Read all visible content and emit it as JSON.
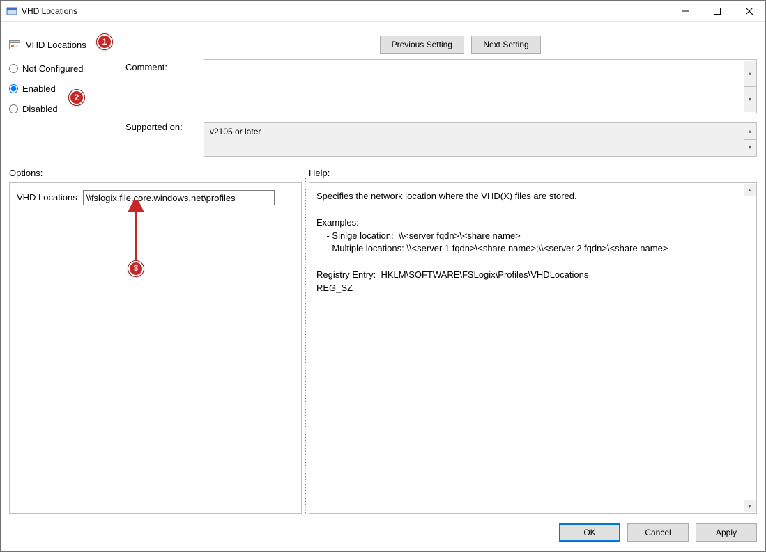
{
  "window": {
    "title": "VHD Locations"
  },
  "header": {
    "title": "VHD Locations",
    "prev_button": "Previous Setting",
    "next_button": "Next Setting"
  },
  "state": {
    "radios": {
      "not_configured": "Not Configured",
      "enabled": "Enabled",
      "disabled": "Disabled",
      "selected": "enabled"
    },
    "comment_label": "Comment:",
    "comment_value": "",
    "supported_label": "Supported on:",
    "supported_value": "v2105 or later"
  },
  "panes": {
    "options_label": "Options:",
    "help_label": "Help:",
    "option_field_label": "VHD Locations",
    "option_field_value": "\\\\fslogix.file.core.windows.net\\profiles",
    "help_text_lines": [
      "Specifies the network location where the VHD(X) files are stored.",
      "",
      "Examples:",
      "    - Sinlge location:  \\\\<server fqdn>\\<share name>",
      "    - Multiple locations: \\\\<server 1 fqdn>\\<share name>;\\\\<server 2 fqdn>\\<share name>",
      "",
      "Registry Entry:  HKLM\\SOFTWARE\\FSLogix\\Profiles\\VHDLocations",
      "REG_SZ"
    ]
  },
  "footer": {
    "ok": "OK",
    "cancel": "Cancel",
    "apply": "Apply"
  },
  "callouts": {
    "c1": "1",
    "c2": "2",
    "c3": "3"
  }
}
